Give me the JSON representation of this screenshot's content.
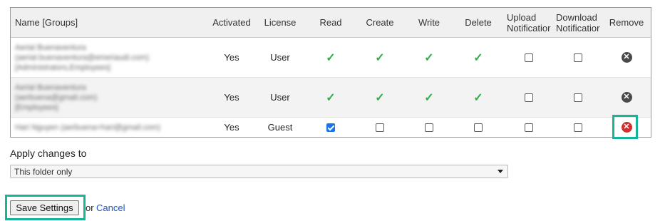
{
  "table": {
    "headers": {
      "name": "Name [Groups]",
      "activated": "Activated",
      "license": "License",
      "read": "Read",
      "create": "Create",
      "write": "Write",
      "delete": "Delete",
      "upload": "Upload\nNotificatior",
      "download": "Download\nNotificatior",
      "remove": "Remove"
    },
    "rows": [
      {
        "name": "Aerial Buenaventura\n(aerial.buenaventura@emeriaudi.com)\n[Administrators,Employees]",
        "activated": "Yes",
        "license": "User",
        "read": "check",
        "create": "check",
        "write": "check",
        "delete": "check",
        "upload": false,
        "download": false,
        "remove_icon": "remove-icon"
      },
      {
        "name": "Aerial Buenaventura\n(aerbuena@gmail.com)\n[Employees]",
        "activated": "Yes",
        "license": "User",
        "read": "check",
        "create": "check",
        "write": "check",
        "delete": "check",
        "upload": false,
        "download": false,
        "remove_icon": "remove-icon"
      },
      {
        "name": "Hari Nguyen (aerbuena+hari@gmail.com)",
        "activated": "Yes",
        "license": "Guest",
        "read": true,
        "create": false,
        "write": false,
        "delete": false,
        "upload": false,
        "download": false,
        "remove_icon": "remove-icon-active"
      }
    ]
  },
  "apply": {
    "label": "Apply changes to",
    "selected": "This folder only"
  },
  "actions": {
    "save_label": "Save Settings",
    "or_text": "or",
    "cancel_label": "Cancel"
  },
  "colors": {
    "highlight": "#18b49a",
    "check": "#2fae4a",
    "remove_active": "#d32f2f",
    "link": "#1f57c3"
  }
}
